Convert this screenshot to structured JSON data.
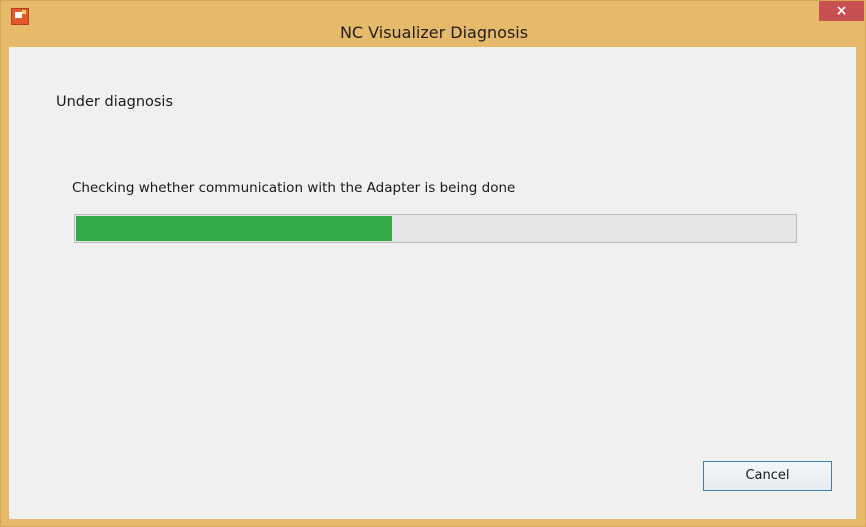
{
  "window": {
    "title": "NC Visualizer Diagnosis",
    "close_glyph": "×",
    "app_icon": "app-icon",
    "close_icon": "close-icon"
  },
  "main": {
    "heading": "Under diagnosis",
    "status_text": "Checking whether communication with the Adapter is being done",
    "progress_fraction": 0.44,
    "cancel_label": "Cancel"
  },
  "colors": {
    "title_bar": "#e7b96a",
    "close_button": "#c75050",
    "progress_fill": "#33a948",
    "progress_track": "#e6e6e6",
    "client_background": "#f0f0f0"
  }
}
